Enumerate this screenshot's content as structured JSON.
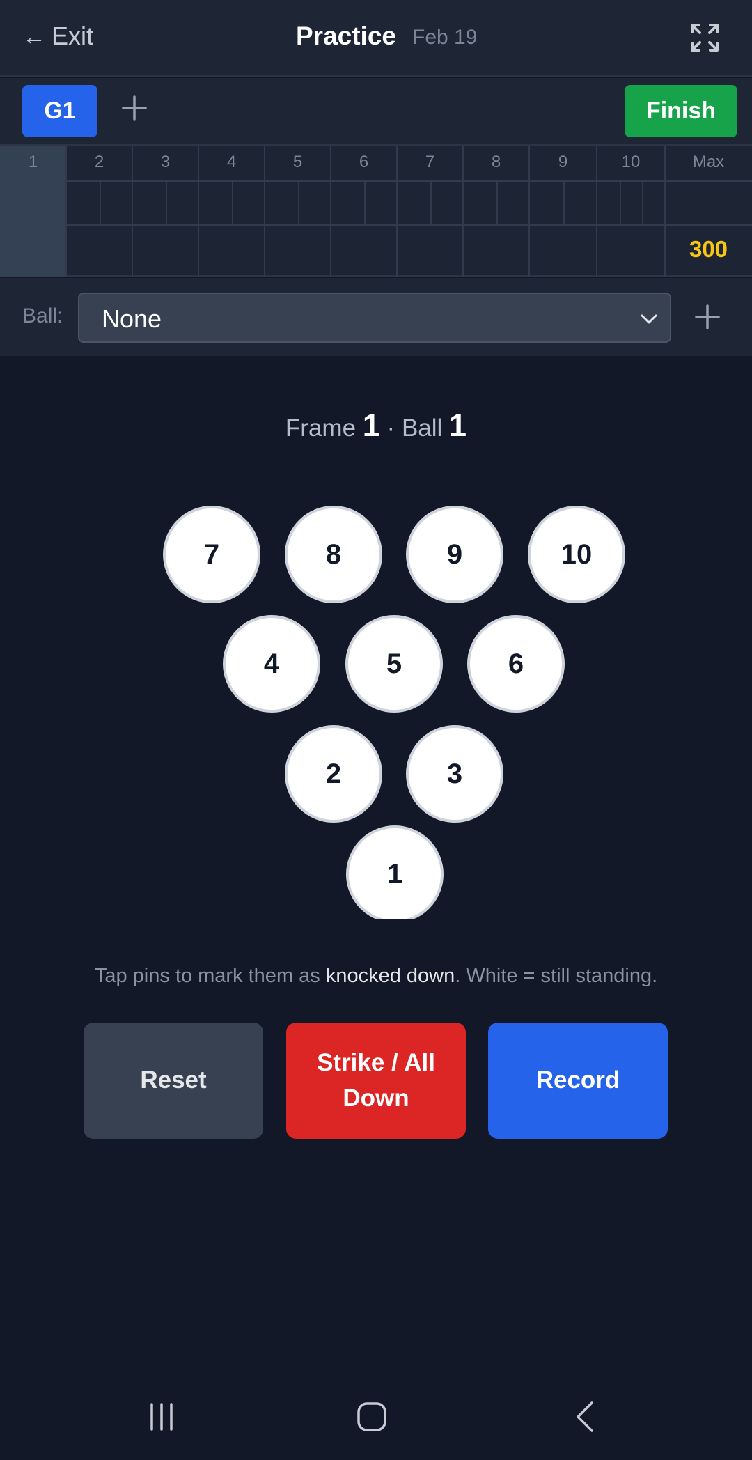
{
  "header": {
    "exit_label": "Exit",
    "title": "Practice",
    "date": "Feb 19"
  },
  "games": {
    "tabs": [
      "G1"
    ],
    "finish_label": "Finish"
  },
  "scoreboard": {
    "frames": [
      "1",
      "2",
      "3",
      "4",
      "5",
      "6",
      "7",
      "8",
      "9",
      "10"
    ],
    "max_label": "Max",
    "max_score": "300",
    "active_frame": 1
  },
  "ball": {
    "label": "Ball:",
    "selected": "None"
  },
  "indicator": {
    "frame_text": "Frame",
    "frame": "1",
    "sep": "·",
    "ball_text": "Ball",
    "ball": "1"
  },
  "pins": [
    "7",
    "8",
    "9",
    "10",
    "4",
    "5",
    "6",
    "2",
    "3",
    "1"
  ],
  "hint": {
    "before": "Tap pins to mark them as ",
    "highlight": "knocked down",
    "after": ". White = still standing."
  },
  "actions": {
    "reset": "Reset",
    "strike": "Strike / All Down",
    "record": "Record"
  },
  "colors": {
    "background": "#121827",
    "primary": "#2563eb",
    "finish": "#16a34a",
    "strike": "#dc2626",
    "max_score": "#f5c518"
  }
}
